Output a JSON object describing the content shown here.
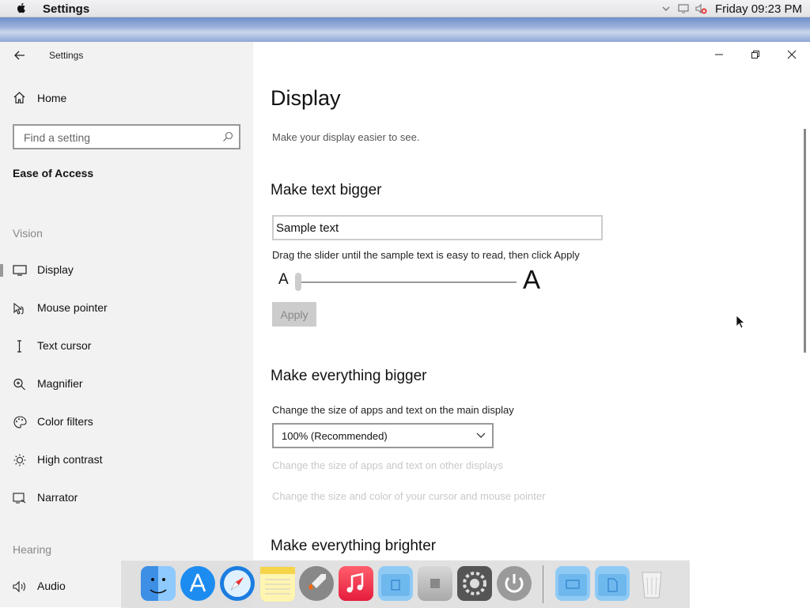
{
  "menubar": {
    "app_name": "Settings",
    "clock": "Friday 09:23 PM",
    "icons": [
      "chevron-down-icon",
      "monitor-icon",
      "volume-muted-icon"
    ]
  },
  "window": {
    "title": "Settings",
    "controls": [
      "minimize-icon",
      "restore-icon",
      "close-icon"
    ]
  },
  "sidebar": {
    "home_label": "Home",
    "search_placeholder": "Find a setting",
    "category": "Ease of Access",
    "vision_label": "Vision",
    "hearing_label": "Hearing",
    "items": [
      {
        "label": "Display",
        "icon": "monitor-icon",
        "active": true
      },
      {
        "label": "Mouse pointer",
        "icon": "mouse-pointer-icon"
      },
      {
        "label": "Text cursor",
        "icon": "text-cursor-icon"
      },
      {
        "label": "Magnifier",
        "icon": "magnifier-icon"
      },
      {
        "label": "Color filters",
        "icon": "palette-icon"
      },
      {
        "label": "High contrast",
        "icon": "sun-icon"
      },
      {
        "label": "Narrator",
        "icon": "narrator-icon"
      },
      {
        "label": "Audio",
        "icon": "speaker-icon"
      }
    ]
  },
  "main": {
    "title": "Display",
    "subtitle": "Make your display easier to see.",
    "text_bigger": {
      "heading": "Make text bigger",
      "sample_text": "Sample text",
      "hint": "Drag the slider until the sample text is easy to read, then click Apply",
      "small_a": "A",
      "big_a": "A",
      "slider_value_percent": 0,
      "apply_label": "Apply"
    },
    "everything_bigger": {
      "heading": "Make everything bigger",
      "label": "Change the size of apps and text on the main display",
      "selected": "100% (Recommended)",
      "other_displays_link": "Change the size of apps and text on other displays",
      "cursor_link": "Change the size and color of your cursor and mouse pointer"
    },
    "brighter": {
      "heading": "Make everything brighter"
    }
  },
  "dock": {
    "apps": [
      "finder-icon",
      "app-store-icon",
      "safari-icon",
      "notes-icon",
      "launchpad-icon",
      "music-icon",
      "downloads-folder-icon",
      "system-drive-icon",
      "system-preferences-icon",
      "power-icon",
      "desktop-folder-icon",
      "documents-folder-icon",
      "trash-icon"
    ]
  }
}
